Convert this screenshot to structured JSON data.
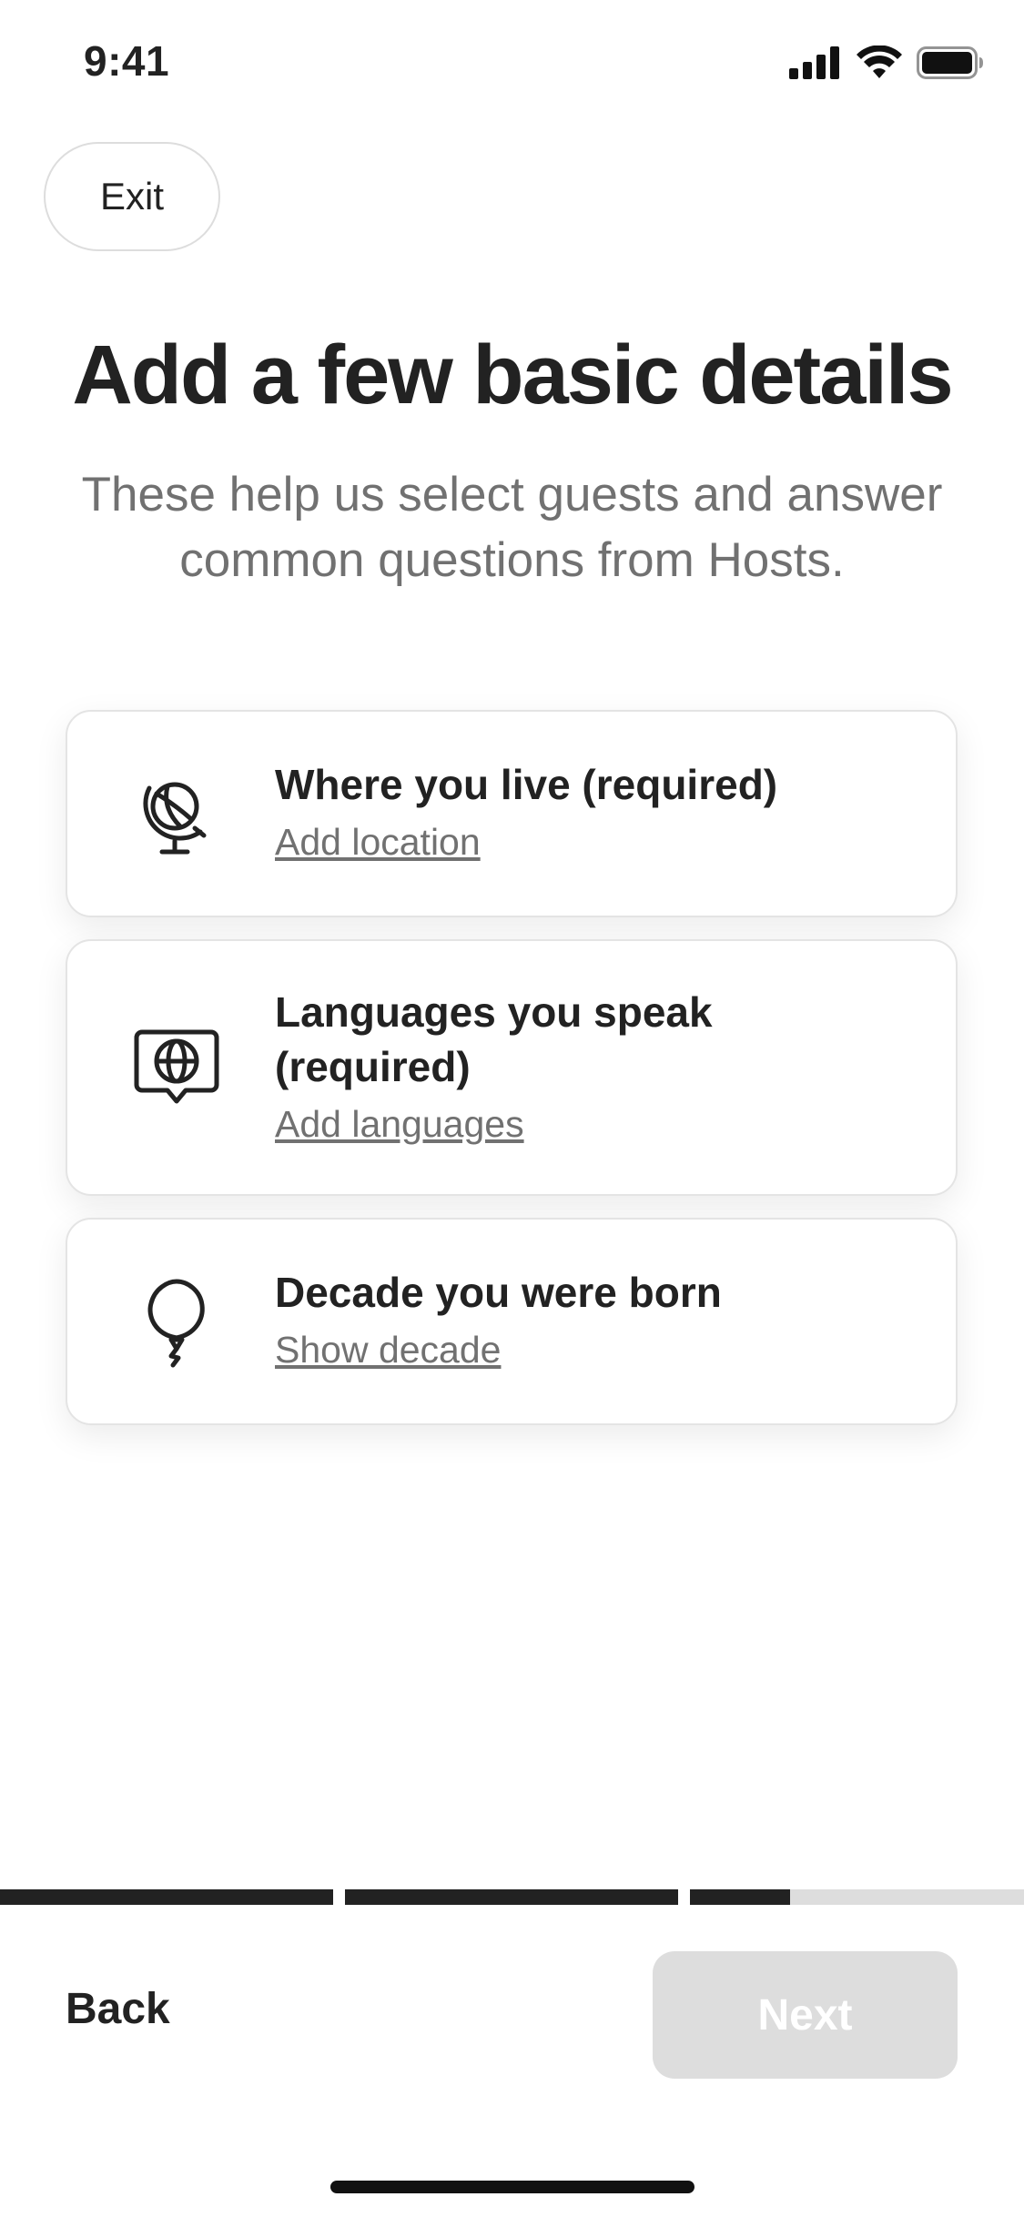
{
  "status_bar": {
    "time": "9:41",
    "icons": [
      "cellular-signal-icon",
      "wifi-icon",
      "battery-icon"
    ]
  },
  "header": {
    "exit_label": "Exit"
  },
  "main": {
    "title": "Add a few basic details",
    "subtitle": "These help us select guests and answer common questions from Hosts.",
    "cards": [
      {
        "icon": "globe-icon",
        "title": "Where you live (required)",
        "link": "Add location"
      },
      {
        "icon": "language-bubble-icon",
        "title": "Languages you speak (required)",
        "link": "Add languages"
      },
      {
        "icon": "balloon-icon",
        "title": "Decade you were born",
        "link": "Show decade"
      }
    ]
  },
  "progress": {
    "steps": [
      {
        "fraction": 1.0
      },
      {
        "fraction": 1.0
      },
      {
        "fraction": 0.3
      }
    ]
  },
  "footer": {
    "back_label": "Back",
    "next_label": "Next",
    "next_enabled": false
  },
  "colors": {
    "text": "#222222",
    "muted": "#717171",
    "progress_active": "#222222",
    "progress_inactive": "#dddddd",
    "next_disabled_bg": "#dddddd"
  }
}
